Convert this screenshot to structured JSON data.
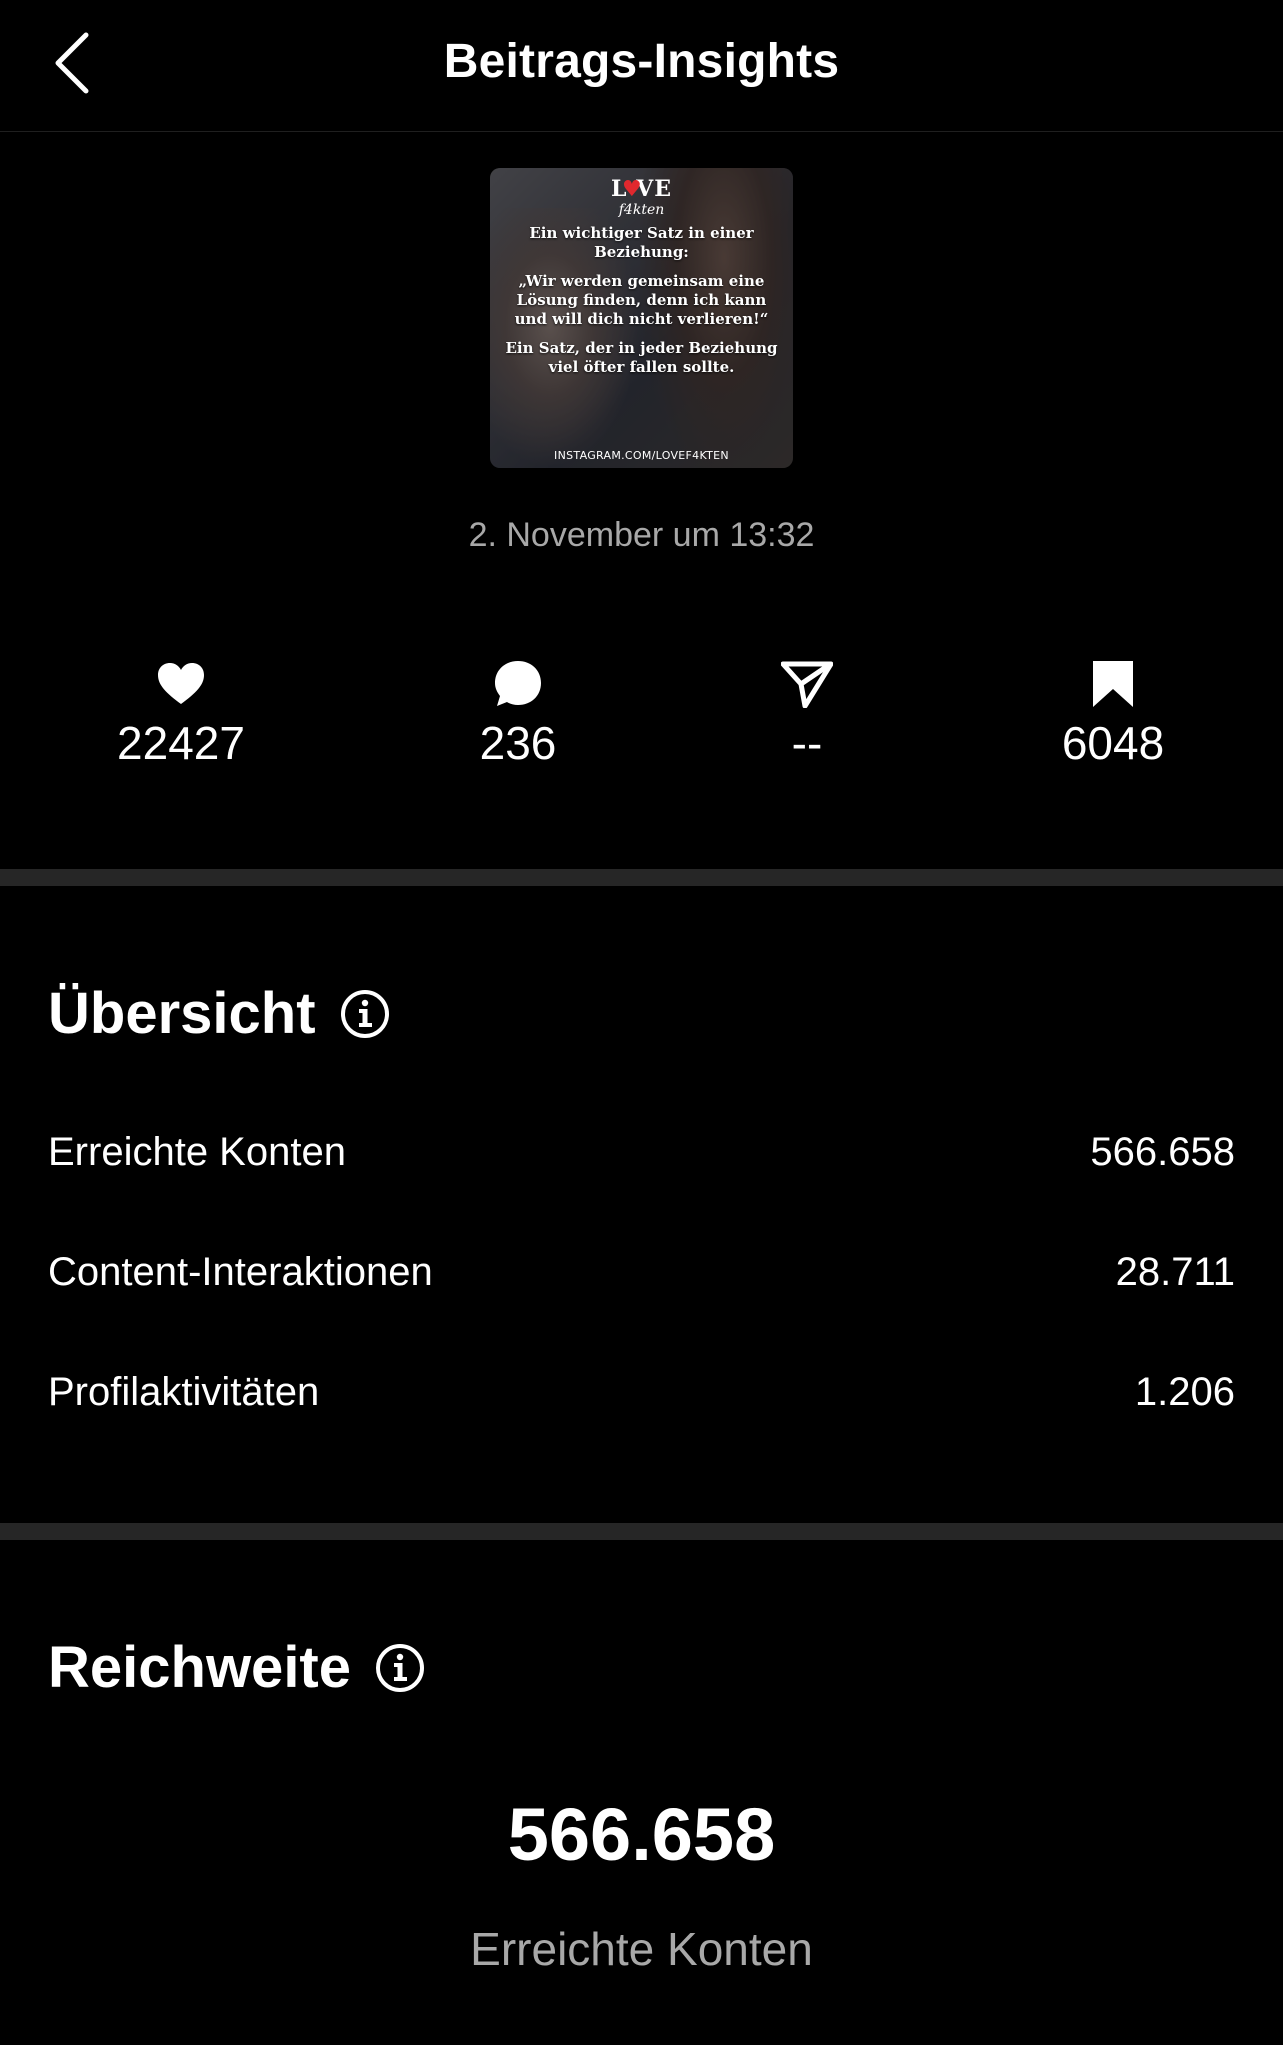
{
  "header": {
    "title": "Beitrags-Insights",
    "back_icon": "chevron-left-icon"
  },
  "post": {
    "thumbnail": {
      "logo_top": "L VE",
      "logo_sub": "f4kten",
      "quote_lines": [
        "Ein wichtiger Satz in einer Beziehung:",
        "„Wir werden gemeinsam eine Lösung finden, denn ich kann und will dich nicht verlieren!“",
        "Ein Satz, der in jeder Beziehung viel öfter fallen sollte."
      ],
      "handle": "INSTAGRAM.COM/LOVEF4KTEN"
    },
    "date": "2. November um 13:32"
  },
  "stats": [
    {
      "icon": "heart-icon",
      "value": "22427"
    },
    {
      "icon": "comment-icon",
      "value": "236"
    },
    {
      "icon": "share-icon",
      "value": "--"
    },
    {
      "icon": "bookmark-icon",
      "value": "6048"
    }
  ],
  "overview": {
    "title": "Übersicht",
    "rows": [
      {
        "label": "Erreichte Konten",
        "value": "566.658"
      },
      {
        "label": "Content-Interaktionen",
        "value": "28.711"
      },
      {
        "label": "Profilaktivitäten",
        "value": "1.206"
      }
    ]
  },
  "reach": {
    "title": "Reichweite",
    "value": "566.658",
    "label": "Erreichte Konten"
  },
  "colors": {
    "background": "#000000",
    "text": "#ffffff",
    "secondary_text": "#a8a8a8",
    "divider": "#262626",
    "logo_heart": "#e0282e"
  }
}
